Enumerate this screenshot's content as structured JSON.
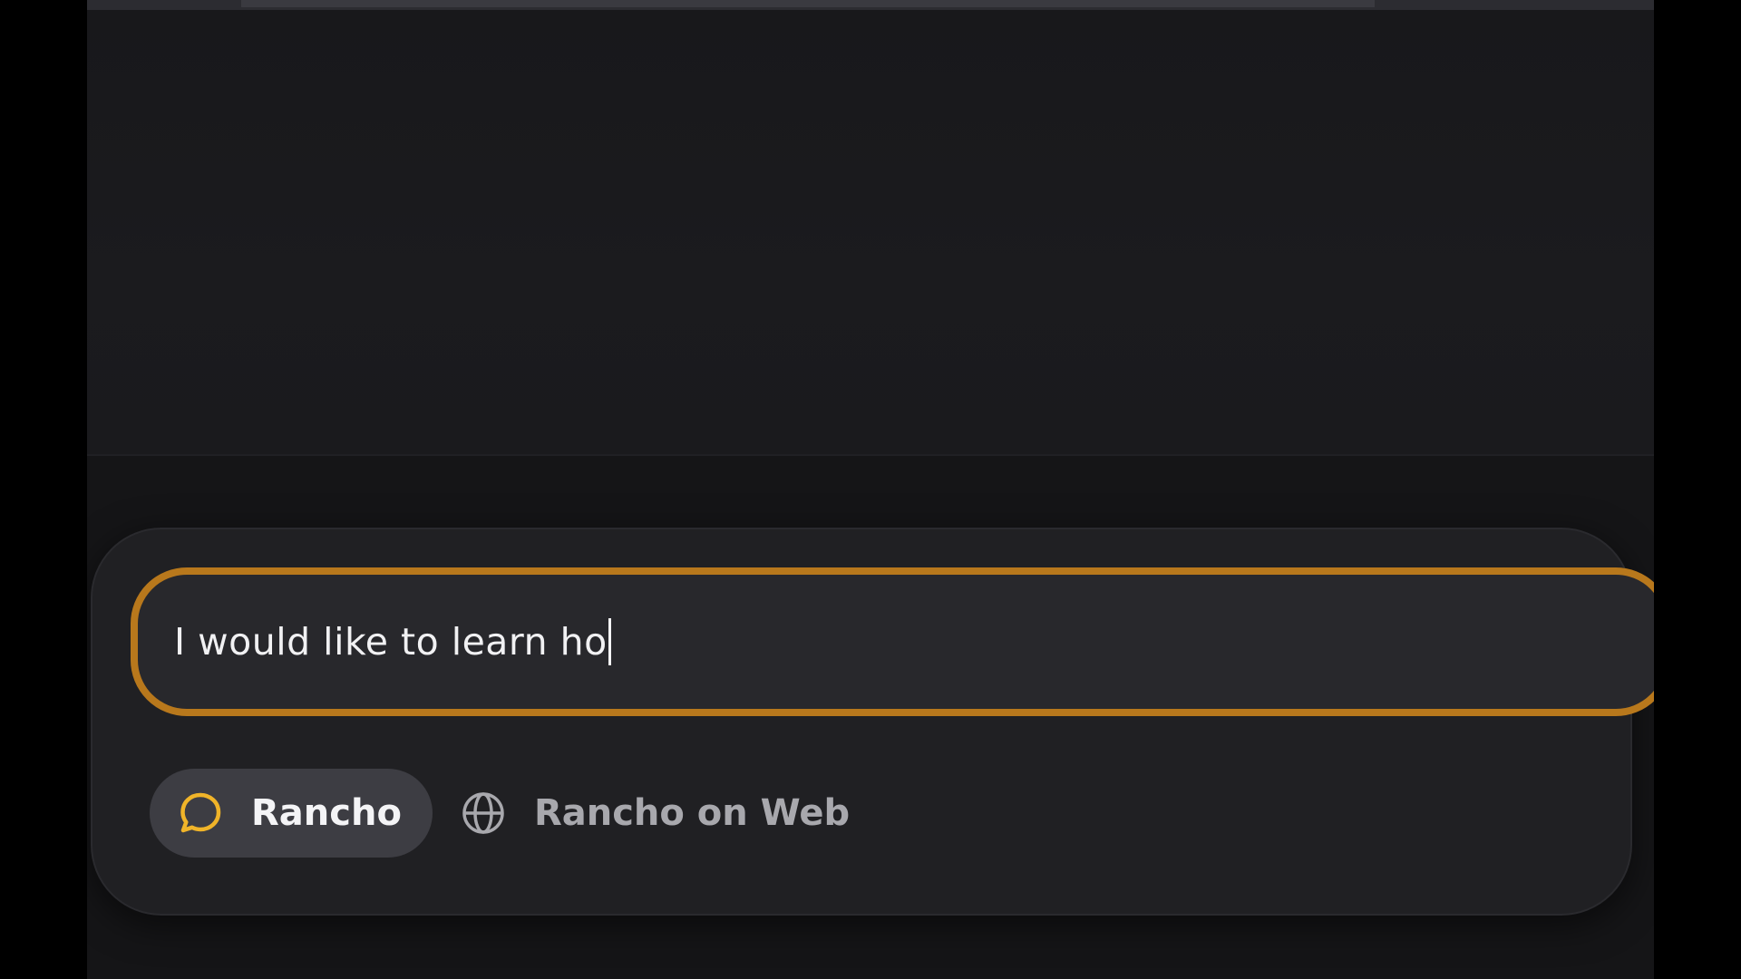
{
  "composer": {
    "input_value": "I would like to learn ho",
    "accent_color": "#b8781c"
  },
  "modes": {
    "items": [
      {
        "label": "Rancho",
        "icon": "chat-bubble-icon",
        "selected": true
      },
      {
        "label": "Rancho on Web",
        "icon": "globe-icon",
        "selected": false
      }
    ]
  }
}
